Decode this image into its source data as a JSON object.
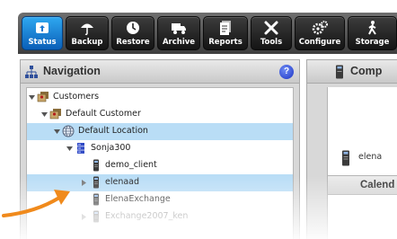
{
  "toolbar": {
    "buttons": [
      {
        "label": "Status",
        "icon": "status-icon",
        "active": true
      },
      {
        "label": "Backup",
        "icon": "umbrella-icon"
      },
      {
        "label": "Restore",
        "icon": "clock-icon"
      },
      {
        "label": "Archive",
        "icon": "truck-icon"
      },
      {
        "label": "Reports",
        "icon": "document-icon"
      },
      {
        "label": "Tools",
        "icon": "tools-icon"
      },
      {
        "label": "Configure",
        "icon": "gears-icon"
      },
      {
        "label": "Storage",
        "icon": "storage-icon"
      }
    ],
    "colors": {
      "active": "#1a86dc",
      "button": "#1f1f1f",
      "bar": "#555555"
    }
  },
  "navigation": {
    "title": "Navigation",
    "help": "?",
    "tree": [
      {
        "label": "Customers",
        "icon": "customers-icon",
        "expanded": true
      },
      {
        "label": "Default Customer",
        "icon": "customer-icon",
        "expanded": true
      },
      {
        "label": "Default Location",
        "icon": "globe-icon",
        "expanded": true,
        "selected": true
      },
      {
        "label": "Sonja300",
        "icon": "server-icon",
        "expanded": true
      },
      {
        "label": "demo_client",
        "icon": "device-icon"
      },
      {
        "label": "elenaad",
        "icon": "device-icon",
        "collapsed": true,
        "selected": true
      },
      {
        "label": "ElenaExchange",
        "icon": "device-icon"
      },
      {
        "label": "Exchange2007_ken",
        "icon": "device-icon",
        "collapsed": true
      }
    ],
    "selection_color": "#b9ddf6"
  },
  "main": {
    "title": "Comp",
    "device_label": "elena",
    "calendar_title": "Calend"
  }
}
